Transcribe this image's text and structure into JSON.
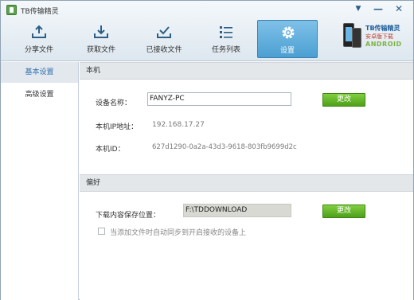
{
  "app": {
    "title": "TB传输精灵"
  },
  "window_controls": {
    "menu": "▼",
    "minimize": "—",
    "close": "✕"
  },
  "toolbar": {
    "items": [
      {
        "label": "分享文件",
        "icon": "upload-tray-icon"
      },
      {
        "label": "获取文件",
        "icon": "download-tray-icon"
      },
      {
        "label": "已接收文件",
        "icon": "received-check-icon"
      },
      {
        "label": "任务列表",
        "icon": "list-icon"
      },
      {
        "label": "设置",
        "icon": "gear-icon",
        "active": true
      }
    ]
  },
  "promo": {
    "name": "TB传输精灵",
    "subtitle": "安卓版下载",
    "platform": "ANDROID"
  },
  "sidebar": {
    "items": [
      {
        "label": "基本设置",
        "active": true
      },
      {
        "label": "高级设置",
        "active": false
      }
    ]
  },
  "local": {
    "heading": "本机",
    "device_name_label": "设备名称：",
    "device_name_value": "FANYZ-PC",
    "change_label": "更改",
    "ip_label": "本机IP地址：",
    "ip_value": "192.168.17.27",
    "id_label": "本机ID：",
    "id_value": "627d1290-0a2a-43d3-9618-803fb9699d2c"
  },
  "prefs": {
    "heading": "偏好",
    "download_label": "下载内容保存位置：",
    "download_value": "F:\\TDDOWNLOAD",
    "change_label": "更改",
    "sync_label": "当添加文件时自动同步到开启接收的设备上",
    "sync_checked": false
  },
  "colors": {
    "accent": "#4b9fd2",
    "button_green": "#5cb025",
    "sidebar_active_text": "#2f6fb1"
  }
}
